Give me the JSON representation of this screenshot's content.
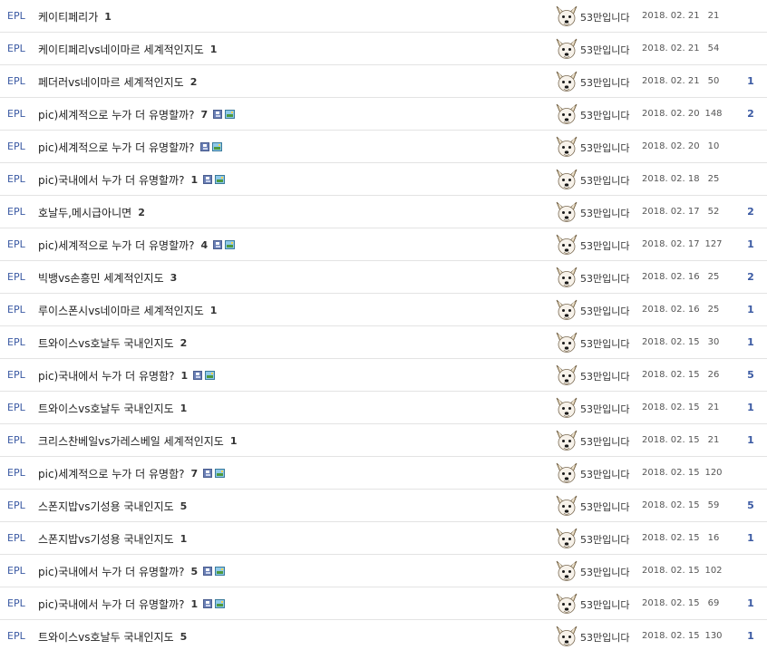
{
  "board": {
    "rows": [
      {
        "category": "EPL",
        "title": "케이티페리가",
        "comments": "1",
        "attachments": false,
        "author": "53만입니다",
        "date": "2018. 02. 21",
        "views": "21",
        "likes": ""
      },
      {
        "category": "EPL",
        "title": "케이티페리vs네이마르 세계적인지도",
        "comments": "1",
        "attachments": false,
        "author": "53만입니다",
        "date": "2018. 02. 21",
        "views": "54",
        "likes": ""
      },
      {
        "category": "EPL",
        "title": "페더러vs네이마르 세계적인지도",
        "comments": "2",
        "attachments": false,
        "author": "53만입니다",
        "date": "2018. 02. 21",
        "views": "50",
        "likes": "1"
      },
      {
        "category": "EPL",
        "title": "pic)세계적으로 누가 더 유명할까?",
        "comments": "7",
        "attachments": true,
        "author": "53만입니다",
        "date": "2018. 02. 20",
        "views": "148",
        "likes": "2"
      },
      {
        "category": "EPL",
        "title": "pic)세계적으로 누가 더 유명할까?",
        "comments": "",
        "attachments": true,
        "author": "53만입니다",
        "date": "2018. 02. 20",
        "views": "10",
        "likes": ""
      },
      {
        "category": "EPL",
        "title": "pic)국내에서 누가 더 유명할까?",
        "comments": "1",
        "attachments": true,
        "author": "53만입니다",
        "date": "2018. 02. 18",
        "views": "25",
        "likes": ""
      },
      {
        "category": "EPL",
        "title": "호날두,메시급아니면",
        "comments": "2",
        "attachments": false,
        "author": "53만입니다",
        "date": "2018. 02. 17",
        "views": "52",
        "likes": "2"
      },
      {
        "category": "EPL",
        "title": "pic)세계적으로 누가 더 유명할까?",
        "comments": "4",
        "attachments": true,
        "author": "53만입니다",
        "date": "2018. 02. 17",
        "views": "127",
        "likes": "1"
      },
      {
        "category": "EPL",
        "title": "빅뱅vs손흥민 세계적인지도",
        "comments": "3",
        "attachments": false,
        "author": "53만입니다",
        "date": "2018. 02. 16",
        "views": "25",
        "likes": "2"
      },
      {
        "category": "EPL",
        "title": "루이스폰시vs네이마르 세계적인지도",
        "comments": "1",
        "attachments": false,
        "author": "53만입니다",
        "date": "2018. 02. 16",
        "views": "25",
        "likes": "1"
      },
      {
        "category": "EPL",
        "title": "트와이스vs호날두 국내인지도",
        "comments": "2",
        "attachments": false,
        "author": "53만입니다",
        "date": "2018. 02. 15",
        "views": "30",
        "likes": "1"
      },
      {
        "category": "EPL",
        "title": "pic)국내에서 누가 더 유명함?",
        "comments": "1",
        "attachments": true,
        "author": "53만입니다",
        "date": "2018. 02. 15",
        "views": "26",
        "likes": "5"
      },
      {
        "category": "EPL",
        "title": "트와이스vs호날두 국내인지도",
        "comments": "1",
        "attachments": false,
        "author": "53만입니다",
        "date": "2018. 02. 15",
        "views": "21",
        "likes": "1"
      },
      {
        "category": "EPL",
        "title": "크리스찬베일vs가레스베일 세계적인지도",
        "comments": "1",
        "attachments": false,
        "author": "53만입니다",
        "date": "2018. 02. 15",
        "views": "21",
        "likes": "1"
      },
      {
        "category": "EPL",
        "title": "pic)세계적으로 누가 더 유명함?",
        "comments": "7",
        "attachments": true,
        "author": "53만입니다",
        "date": "2018. 02. 15",
        "views": "120",
        "likes": ""
      },
      {
        "category": "EPL",
        "title": "스폰지밥vs기성용 국내인지도",
        "comments": "5",
        "attachments": false,
        "author": "53만입니다",
        "date": "2018. 02. 15",
        "views": "59",
        "likes": "5"
      },
      {
        "category": "EPL",
        "title": "스폰지밥vs기성용 국내인지도",
        "comments": "1",
        "attachments": false,
        "author": "53만입니다",
        "date": "2018. 02. 15",
        "views": "16",
        "likes": "1"
      },
      {
        "category": "EPL",
        "title": "pic)국내에서 누가 더 유명할까?",
        "comments": "5",
        "attachments": true,
        "author": "53만입니다",
        "date": "2018. 02. 15",
        "views": "102",
        "likes": ""
      },
      {
        "category": "EPL",
        "title": "pic)국내에서 누가 더 유명할까?",
        "comments": "1",
        "attachments": true,
        "author": "53만입니다",
        "date": "2018. 02. 15",
        "views": "69",
        "likes": "1"
      },
      {
        "category": "EPL",
        "title": "트와이스vs호날두 국내인지도",
        "comments": "5",
        "attachments": false,
        "author": "53만입니다",
        "date": "2018. 02. 15",
        "views": "130",
        "likes": "1"
      }
    ]
  },
  "icons": {
    "avatar": "dog-avatar-icon",
    "file": "disk-icon",
    "image": "image-icon"
  },
  "colors": {
    "category": "#3b5aa3",
    "likes": "#3b5aa3",
    "row_divider": "#e3e3e3"
  }
}
